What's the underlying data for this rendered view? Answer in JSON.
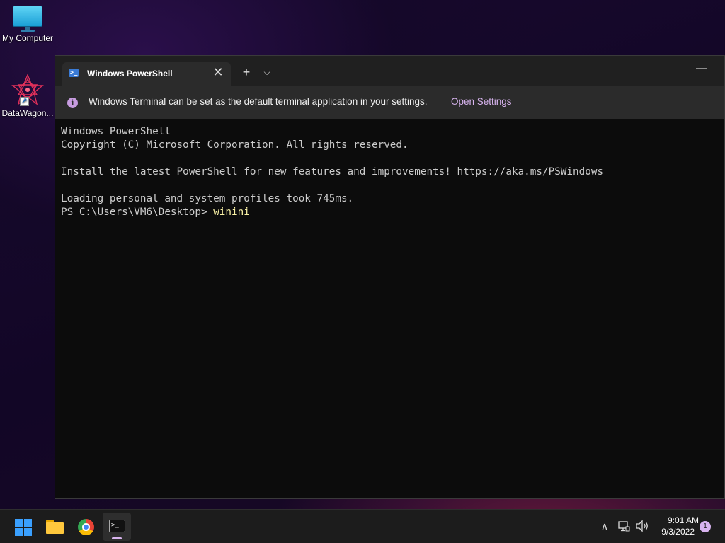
{
  "desktop": {
    "icons": [
      {
        "label": "My Computer",
        "icon": "computer-icon"
      },
      {
        "label": "DataWagon...",
        "icon": "datawagon-icon"
      }
    ]
  },
  "terminal": {
    "tab": {
      "title": "Windows PowerShell",
      "close_glyph": "✕",
      "icon": "powershell-icon",
      "icon_glyph": ">_"
    },
    "new_tab_glyph": "+",
    "dropdown_glyph": "⌵",
    "minimize_glyph": "—",
    "infobar": {
      "icon_glyph": "i",
      "message": "Windows Terminal can be set as the default terminal application in your settings.",
      "link": "Open Settings"
    },
    "console": {
      "lines": [
        "Windows PowerShell",
        "Copyright (C) Microsoft Corporation. All rights reserved.",
        "",
        "Install the latest PowerShell for new features and improvements! https://aka.ms/PSWindows",
        "",
        "Loading personal and system profiles took 745ms."
      ],
      "prompt": "PS C:\\Users\\VM6\\Desktop> ",
      "command": "winini"
    }
  },
  "taskbar": {
    "apps": [
      {
        "name": "Start",
        "icon": "windows-logo-icon"
      },
      {
        "name": "File Explorer",
        "icon": "folder-icon"
      },
      {
        "name": "Google Chrome",
        "icon": "chrome-icon"
      },
      {
        "name": "Windows Terminal",
        "icon": "terminal-icon",
        "running": true
      }
    ],
    "tray": {
      "chevron_glyph": "∧",
      "time": "9:01 AM",
      "date": "9/3/2022",
      "notifications": "1"
    }
  },
  "colors": {
    "accent": "#d8b4ef",
    "terminal_bg": "#0c0c0c",
    "command_text": "#f9f1a5"
  }
}
